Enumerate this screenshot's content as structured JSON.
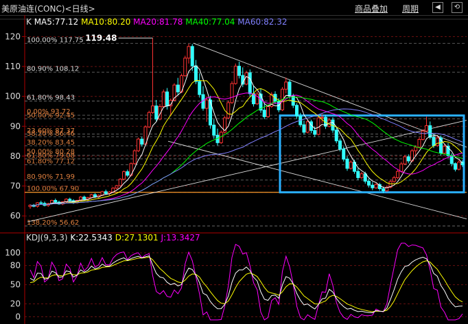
{
  "window": {
    "title": "美原油连(CONC)<日线>",
    "compare_label": "商品叠加",
    "period_label": "周期"
  },
  "colors": {
    "up": "#ff3232",
    "down": "#32ffff",
    "ma5": "#ffffff",
    "ma10": "#ffff00",
    "ma20": "#ff00ff",
    "ma40": "#00ff00",
    "ma60": "#8080ff",
    "k": "#ffffff",
    "d": "#ffff00",
    "j": "#ff00ff",
    "axis": "#b00000",
    "fib": "#e08040",
    "box": "#2ab0ff"
  },
  "chart_data": [
    {
      "type": "candlestick",
      "title": "K",
      "legend": [
        {
          "name": "MA5",
          "value": "77.12"
        },
        {
          "name": "MA10",
          "value": "80.20"
        },
        {
          "name": "MA20",
          "value": "81.78"
        },
        {
          "name": "MA40",
          "value": "77.04"
        },
        {
          "name": "MA60",
          "value": "82.32"
        }
      ],
      "y_ticks": [
        60,
        70,
        80,
        90,
        100,
        110,
        120
      ],
      "ylim": [
        55,
        124
      ],
      "peak_label": "119.48",
      "fib_labels": [
        {
          "text": "100.00% 117.75",
          "price": 117.75
        },
        {
          "text": "80.90% 108.12",
          "price": 108.12
        },
        {
          "text": "61.80% 98.43",
          "price": 98.43
        },
        {
          "text": "0.00% 93.72",
          "price": 93.72
        },
        {
          "text": "50.00% 92.45",
          "price": 92.45
        },
        {
          "text": "23.60% 87.37",
          "price": 87.37
        },
        {
          "text": "38.20% 86.46",
          "price": 86.46
        },
        {
          "text": "38.20% 83.45",
          "price": 83.45
        },
        {
          "text": "50.00% 80.28",
          "price": 80.28
        },
        {
          "text": "61.80% 79.08",
          "price": 79.08
        },
        {
          "text": "61.80% 77.12",
          "price": 77.12
        },
        {
          "text": "80.90% 71.99",
          "price": 71.99
        },
        {
          "text": "100.00% 67.90",
          "price": 67.9
        },
        {
          "text": "138.20% 56.62",
          "price": 56.62
        }
      ],
      "ohlc": [
        [
          63.1,
          63.9,
          62.4,
          63.6
        ],
        [
          63.6,
          64.0,
          62.9,
          63.2
        ],
        [
          63.2,
          64.6,
          62.8,
          64.4
        ],
        [
          64.4,
          65.1,
          63.9,
          64.2
        ],
        [
          64.2,
          64.8,
          63.2,
          63.5
        ],
        [
          63.5,
          64.4,
          63.0,
          64.1
        ],
        [
          64.1,
          65.4,
          63.8,
          65.2
        ],
        [
          65.2,
          65.8,
          64.3,
          64.6
        ],
        [
          64.6,
          65.1,
          63.7,
          64.0
        ],
        [
          64.0,
          64.9,
          63.6,
          64.7
        ],
        [
          64.7,
          65.9,
          64.4,
          65.6
        ],
        [
          65.6,
          66.1,
          64.8,
          65.1
        ],
        [
          65.1,
          65.6,
          64.0,
          64.4
        ],
        [
          64.4,
          65.4,
          64.1,
          65.2
        ],
        [
          65.2,
          66.6,
          64.9,
          66.3
        ],
        [
          66.3,
          66.8,
          65.2,
          65.6
        ],
        [
          65.6,
          66.4,
          64.9,
          66.1
        ],
        [
          66.1,
          67.4,
          65.8,
          67.1
        ],
        [
          67.1,
          67.6,
          66.0,
          66.4
        ],
        [
          66.4,
          67.2,
          65.7,
          66.9
        ],
        [
          66.9,
          68.4,
          66.6,
          68.1
        ],
        [
          68.1,
          68.8,
          67.0,
          67.5
        ],
        [
          67.5,
          68.3,
          66.9,
          68.0
        ],
        [
          68.0,
          69.6,
          67.7,
          69.3
        ],
        [
          69.3,
          70.4,
          68.9,
          70.1
        ],
        [
          70.1,
          72.6,
          69.8,
          72.3
        ],
        [
          72.3,
          75.2,
          71.9,
          74.8
        ],
        [
          74.8,
          75.5,
          73.0,
          73.6
        ],
        [
          73.6,
          77.9,
          73.2,
          77.5
        ],
        [
          77.5,
          82.3,
          77.1,
          81.8
        ],
        [
          81.8,
          86.2,
          81.4,
          85.7
        ],
        [
          85.7,
          86.5,
          83.2,
          84.0
        ],
        [
          84.0,
          90.3,
          83.6,
          89.8
        ],
        [
          89.8,
          95.2,
          89.4,
          94.6
        ],
        [
          94.6,
          119.5,
          94.2,
          96.8
        ],
        [
          96.8,
          98.8,
          91.6,
          92.4
        ],
        [
          92.4,
          97.4,
          92.0,
          96.6
        ],
        [
          96.6,
          102.3,
          96.2,
          101.5
        ],
        [
          101.5,
          102.8,
          95.6,
          96.8
        ],
        [
          96.8,
          99.3,
          93.6,
          98.7
        ],
        [
          98.7,
          104.4,
          98.3,
          103.8
        ],
        [
          103.8,
          106.2,
          100.4,
          101.5
        ],
        [
          101.5,
          107.6,
          101.1,
          106.9
        ],
        [
          106.9,
          113.6,
          106.5,
          112.8
        ],
        [
          112.8,
          117.6,
          111.0,
          116.7
        ],
        [
          116.7,
          117.5,
          108.5,
          110.2
        ],
        [
          110.2,
          112.2,
          104.1,
          105.0
        ],
        [
          105.0,
          107.8,
          99.6,
          100.6
        ],
        [
          100.6,
          103.4,
          95.2,
          96.0
        ],
        [
          96.0,
          99.8,
          91.5,
          98.8
        ],
        [
          98.8,
          100.2,
          89.2,
          90.4
        ],
        [
          90.4,
          92.3,
          85.8,
          87.0
        ],
        [
          87.0,
          89.2,
          83.6,
          84.5
        ],
        [
          84.5,
          88.6,
          84.1,
          88.0
        ],
        [
          88.0,
          93.4,
          87.6,
          92.8
        ],
        [
          92.8,
          98.6,
          92.4,
          97.9
        ],
        [
          97.9,
          105.1,
          97.5,
          104.3
        ],
        [
          104.3,
          111.0,
          103.9,
          110.1
        ],
        [
          110.1,
          111.6,
          106.0,
          107.0
        ],
        [
          107.0,
          109.7,
          103.1,
          104.1
        ],
        [
          104.1,
          108.6,
          103.7,
          107.9
        ],
        [
          107.9,
          109.0,
          99.7,
          100.9
        ],
        [
          100.9,
          103.4,
          96.6,
          97.5
        ],
        [
          97.5,
          101.6,
          97.1,
          100.8
        ],
        [
          100.8,
          102.5,
          94.5,
          95.4
        ],
        [
          95.4,
          97.7,
          92.4,
          93.2
        ],
        [
          93.2,
          97.3,
          92.8,
          96.6
        ],
        [
          96.6,
          101.4,
          96.2,
          100.7
        ],
        [
          100.7,
          101.7,
          97.4,
          98.3
        ],
        [
          98.3,
          99.4,
          94.7,
          95.5
        ],
        [
          95.5,
          103.1,
          95.1,
          102.4
        ],
        [
          102.4,
          106.3,
          101.0,
          104.8
        ],
        [
          104.8,
          105.6,
          99.2,
          100.1
        ],
        [
          100.1,
          100.9,
          96.1,
          97.0
        ],
        [
          97.0,
          97.7,
          92.5,
          93.4
        ],
        [
          93.4,
          94.5,
          89.7,
          90.5
        ],
        [
          90.5,
          91.9,
          87.2,
          88.0
        ],
        [
          88.0,
          92.2,
          87.6,
          91.5
        ],
        [
          91.5,
          92.2,
          87.7,
          88.6
        ],
        [
          88.6,
          89.9,
          86.4,
          87.3
        ],
        [
          87.3,
          93.4,
          86.9,
          92.8
        ],
        [
          92.8,
          94.1,
          91.1,
          93.0
        ],
        [
          93.0,
          93.8,
          89.1,
          90.0
        ],
        [
          90.0,
          92.7,
          89.6,
          92.1
        ],
        [
          92.1,
          93.0,
          87.8,
          88.7
        ],
        [
          88.7,
          89.5,
          84.3,
          85.1
        ],
        [
          85.1,
          85.9,
          81.6,
          82.4
        ],
        [
          82.4,
          83.2,
          78.2,
          79.0
        ],
        [
          79.0,
          80.0,
          75.1,
          75.9
        ],
        [
          75.9,
          78.6,
          75.5,
          78.0
        ],
        [
          78.0,
          78.8,
          74.1,
          74.9
        ],
        [
          74.9,
          75.9,
          72.0,
          72.8
        ],
        [
          72.8,
          74.7,
          72.4,
          74.1
        ],
        [
          74.1,
          74.8,
          70.8,
          71.6
        ],
        [
          71.6,
          72.5,
          69.5,
          70.3
        ],
        [
          70.3,
          71.3,
          68.6,
          69.4
        ],
        [
          69.4,
          71.1,
          69.0,
          70.5
        ],
        [
          70.5,
          71.1,
          68.4,
          69.1
        ],
        [
          69.1,
          69.8,
          67.6,
          68.4
        ],
        [
          68.4,
          70.2,
          68.0,
          69.6
        ],
        [
          69.6,
          72.1,
          69.2,
          71.5
        ],
        [
          71.5,
          73.4,
          71.1,
          72.8
        ],
        [
          72.8,
          75.5,
          72.4,
          74.9
        ],
        [
          74.9,
          78.1,
          74.5,
          77.4
        ],
        [
          77.4,
          80.4,
          77.0,
          79.8
        ],
        [
          79.8,
          80.6,
          77.6,
          78.4
        ],
        [
          78.4,
          82.4,
          78.0,
          81.8
        ],
        [
          81.8,
          83.6,
          80.3,
          83.0
        ],
        [
          83.0,
          86.3,
          82.6,
          85.6
        ],
        [
          85.6,
          89.0,
          85.2,
          88.4
        ],
        [
          88.4,
          93.2,
          88.0,
          90.2
        ],
        [
          90.2,
          91.6,
          85.6,
          86.3
        ],
        [
          86.3,
          87.4,
          82.7,
          83.5
        ],
        [
          83.5,
          87.0,
          83.1,
          86.1
        ],
        [
          86.1,
          86.9,
          80.2,
          81.0
        ],
        [
          81.0,
          84.0,
          80.6,
          83.3
        ],
        [
          83.3,
          84.4,
          79.4,
          80.2
        ],
        [
          80.2,
          81.0,
          76.6,
          77.5
        ],
        [
          77.5,
          77.9,
          74.9,
          75.6
        ],
        [
          75.6,
          78.6,
          75.2,
          78.0
        ],
        [
          78.0,
          78.6,
          76.4,
          77.1
        ]
      ]
    },
    {
      "type": "line",
      "title": "KDJ(9,3,3)",
      "legend": [
        {
          "name": "K",
          "value": "22.5343"
        },
        {
          "name": "D",
          "value": "27.1301"
        },
        {
          "name": "J",
          "value": "13.3427"
        }
      ],
      "y_ticks": [
        0,
        20,
        50,
        80,
        100
      ],
      "ylim": [
        -5,
        115
      ]
    }
  ]
}
